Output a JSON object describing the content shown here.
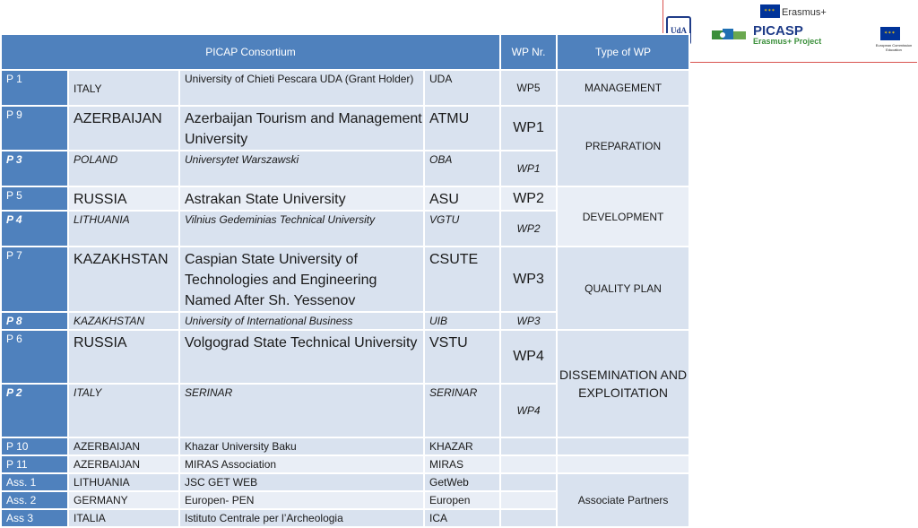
{
  "logos": {
    "erasmus_label": "Erasmus+",
    "picasp_title": "PICASP",
    "picasp_subtitle": "Erasmus+ Project",
    "ec_text": "European Commission Education"
  },
  "table": {
    "header": {
      "consortium": "PICAP Consortium",
      "wp_nr": "WP Nr.",
      "type_of_wp": "Type of WP"
    },
    "rows": [
      {
        "p": "P 1",
        "country": "ITALY",
        "university": "University of Chieti Pescara UDA  (Grant Holder)",
        "abbr": "UDA",
        "wp": "WP5",
        "type": "MANAGEMENT"
      },
      {
        "p": "P 9",
        "country": "AZERBAIJAN",
        "university": "Azerbaijan Tourism and Management University",
        "abbr": "ATMU",
        "wp": "WP1",
        "type": "PREPARATION"
      },
      {
        "p": "P 3",
        "country": "POLAND",
        "university": "Universytet Warszawski",
        "abbr": "OBA",
        "wp": "WP1"
      },
      {
        "p": "P 5",
        "country": "RUSSIA",
        "university": "Astrakan State University",
        "abbr": "ASU",
        "wp": "WP2",
        "type": "DEVELOPMENT"
      },
      {
        "p": "P 4",
        "country": "LITHUANIA",
        "university": "Vilnius Gedeminias Technical University",
        "abbr": "VGTU",
        "wp": "WP2"
      },
      {
        "p": "P 7",
        "country": "KAZAKHSTAN",
        "university": "Caspian State University of Technologies and Engineering Named After Sh. Yessenov",
        "abbr": "CSUTE",
        "wp": "WP3",
        "type": "QUALITY PLAN"
      },
      {
        "p": "P 8",
        "country": "KAZAKHSTAN",
        "university": "University of International Business",
        "abbr": "UIB",
        "wp": "WP3"
      },
      {
        "p": "P 6",
        "country": "RUSSIA",
        "university": "Volgograd State Technical University",
        "abbr": "VSTU",
        "wp": "WP4",
        "type": "DISSEMINATION AND EXPLOITATION"
      },
      {
        "p": "P 2",
        "country": "ITALY",
        "university": "SERINAR",
        "abbr": "SERINAR",
        "wp": "WP4"
      },
      {
        "p": "P 10",
        "country": "AZERBAIJAN",
        "university": "Khazar University Baku",
        "abbr": "KHAZAR",
        "wp": ""
      },
      {
        "p": "P 11",
        "country": "AZERBAIJAN",
        "university": "MIRAS Association",
        "abbr": "MIRAS",
        "wp": ""
      },
      {
        "p": "Ass. 1",
        "country": "LITHUANIA",
        "university": "JSC GET WEB",
        "abbr": "GetWeb",
        "wp": "",
        "type": "Associate Partners"
      },
      {
        "p": "Ass. 2",
        "country": "GERMANY",
        "university": "Europen- PEN",
        "abbr": "Europen",
        "wp": ""
      },
      {
        "p": "Ass  3",
        "country": "ITALIA",
        "university": "Istituto Centrale per l’Archeologia",
        "abbr": "ICA",
        "wp": ""
      }
    ]
  }
}
